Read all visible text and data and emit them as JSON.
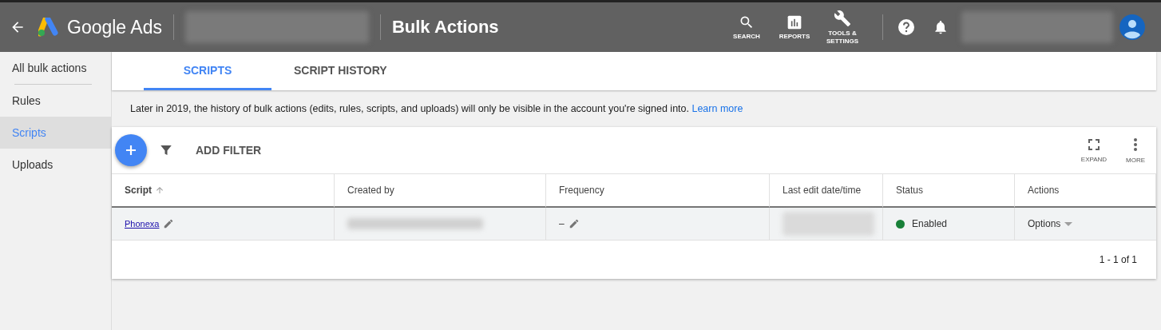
{
  "header": {
    "brand": "Google Ads",
    "page_title": "Bulk Actions",
    "tools": [
      {
        "kind": "search",
        "label": "SEARCH"
      },
      {
        "kind": "reports",
        "label": "REPORTS"
      },
      {
        "kind": "tools",
        "label": "TOOLS & SETTINGS"
      }
    ]
  },
  "sidebar": {
    "items": [
      {
        "label": "All bulk actions",
        "selected": false
      },
      {
        "label": "Rules",
        "selected": false
      },
      {
        "label": "Scripts",
        "selected": true
      },
      {
        "label": "Uploads",
        "selected": false
      }
    ]
  },
  "tabs": [
    {
      "label": "SCRIPTS",
      "selected": true
    },
    {
      "label": "SCRIPT HISTORY",
      "selected": false
    }
  ],
  "notice": {
    "text": "Later in 2019, the history of bulk actions (edits, rules, scripts, and uploads) will only be visible in the account you're signed into.",
    "link": "Learn more"
  },
  "toolbar": {
    "filter_label": "ADD FILTER",
    "actions": [
      {
        "kind": "expand",
        "label": "EXPAND"
      },
      {
        "kind": "more",
        "label": "MORE"
      }
    ]
  },
  "table": {
    "columns": [
      "Script",
      "Created by",
      "Frequency",
      "Last edit date/time",
      "Status",
      "Actions"
    ],
    "rows": [
      {
        "script": "Phonexa",
        "frequency": "–",
        "status": "Enabled",
        "color": "#188038",
        "actions": "Options"
      }
    ]
  },
  "pagination": "1 - 1 of 1"
}
